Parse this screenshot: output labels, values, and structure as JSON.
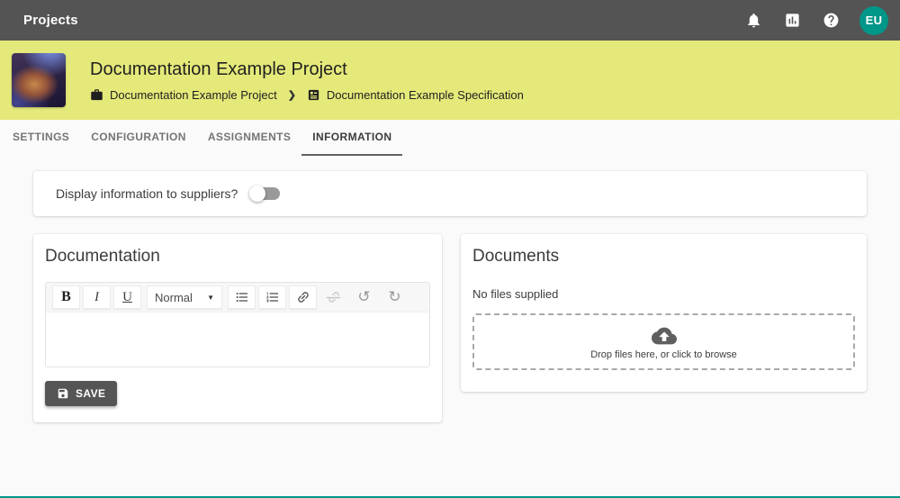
{
  "colors": {
    "topbar_bg": "#545454",
    "banner_bg": "#e5e97a",
    "avatar_bg": "#009688",
    "page_bg": "#fafafa",
    "button_bg": "#555555",
    "bottom_line": "#009688"
  },
  "topbar": {
    "title": "Projects",
    "icons": [
      "notifications-icon",
      "analytics-icon",
      "help-icon"
    ],
    "avatar_initials": "EU"
  },
  "banner": {
    "title": "Documentation Example Project",
    "breadcrumb": [
      {
        "icon": "briefcase-icon",
        "label": "Documentation Example Project"
      },
      {
        "icon": "specification-icon",
        "label": "Documentation Example Specification"
      }
    ],
    "separator": "❯"
  },
  "tabs": [
    {
      "label": "SETTINGS",
      "active": false
    },
    {
      "label": "CONFIGURATION",
      "active": false
    },
    {
      "label": "ASSIGNMENTS",
      "active": false
    },
    {
      "label": "INFORMATION",
      "active": true
    }
  ],
  "supplier_toggle": {
    "label": "Display information to suppliers?",
    "state": "off"
  },
  "documentation_card": {
    "title": "Documentation",
    "editor": {
      "bold_label": "B",
      "italic_label": "I",
      "underline_label": "U",
      "format_value": "Normal",
      "caret": "▼",
      "undo_glyph": "↺",
      "redo_glyph": "↻",
      "content": ""
    },
    "save_label": "SAVE"
  },
  "documents_card": {
    "title": "Documents",
    "empty_text": "No files supplied",
    "dropzone_text": "Drop files here, or click to browse"
  }
}
